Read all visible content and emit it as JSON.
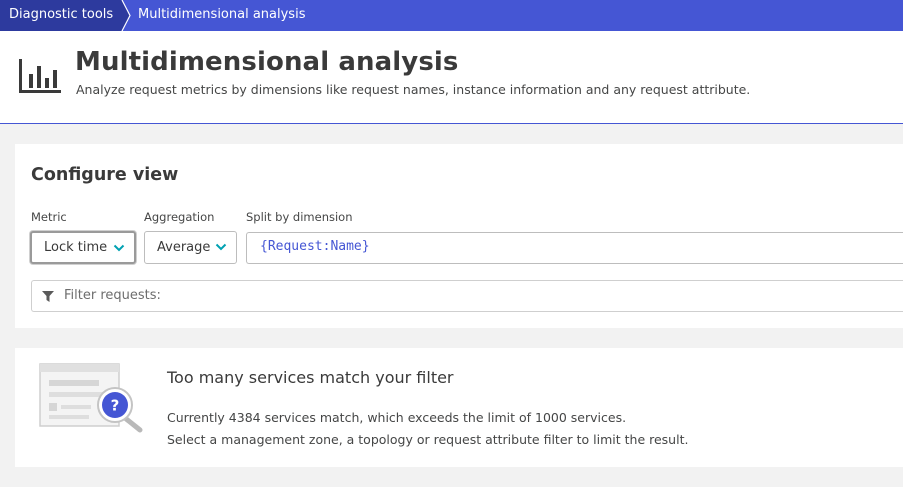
{
  "breadcrumb": {
    "items": [
      "Diagnostic tools",
      "Multidimensional analysis"
    ]
  },
  "header": {
    "icon": "bar-chart-icon",
    "title": "Multidimensional analysis",
    "subtitle": "Analyze request metrics by dimensions like request names, instance information and any request attribute."
  },
  "configure": {
    "title": "Configure view",
    "metric": {
      "label": "Metric",
      "value": "Lock time"
    },
    "aggregation": {
      "label": "Aggregation",
      "value": "Average"
    },
    "split": {
      "label": "Split by dimension",
      "value": "{Request:Name}"
    },
    "filter": {
      "placeholder": "Filter requests:"
    }
  },
  "message": {
    "title": "Too many services match your filter",
    "line1": "Currently 4384 services match, which exceeds the limit of 1000 services.",
    "line2": "Select a management zone, a topology or request attribute filter to limit the result."
  },
  "colors": {
    "breadcrumb_bg": "#4556d4",
    "breadcrumb_active_bg": "#2d3a9e",
    "accent": "#00a1b2",
    "token": "#4556d4"
  }
}
